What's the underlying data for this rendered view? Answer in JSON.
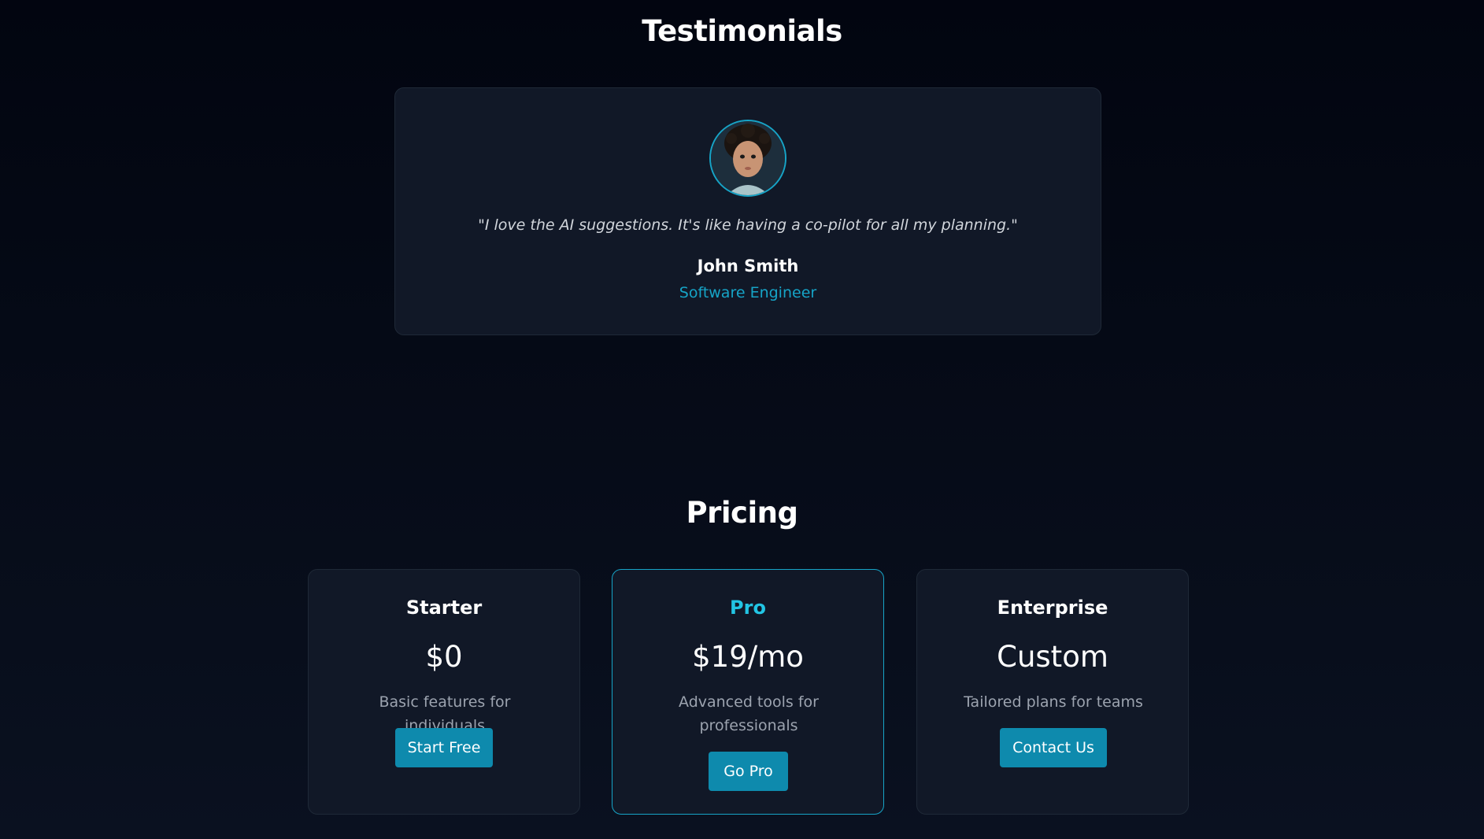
{
  "testimonials": {
    "title": "Testimonials",
    "items": [
      {
        "quote": "\"I love the AI suggestions. It's like having a co-pilot for all my planning.\"",
        "name": "John Smith",
        "role": "Software Engineer"
      }
    ]
  },
  "pricing": {
    "title": "Pricing",
    "plans": [
      {
        "name": "Starter",
        "price": "$0",
        "description": "Basic features for individuals",
        "button": "Start Free"
      },
      {
        "name": "Pro",
        "price": "$19/mo",
        "description": "Advanced tools for professionals",
        "button": "Go Pro"
      },
      {
        "name": "Enterprise",
        "price": "Custom",
        "description": "Tailored plans for teams",
        "button": "Contact Us"
      }
    ]
  },
  "colors": {
    "background": "#030712",
    "card": "#111827",
    "accent": "#16a4c7",
    "button": "#0e8aad"
  }
}
